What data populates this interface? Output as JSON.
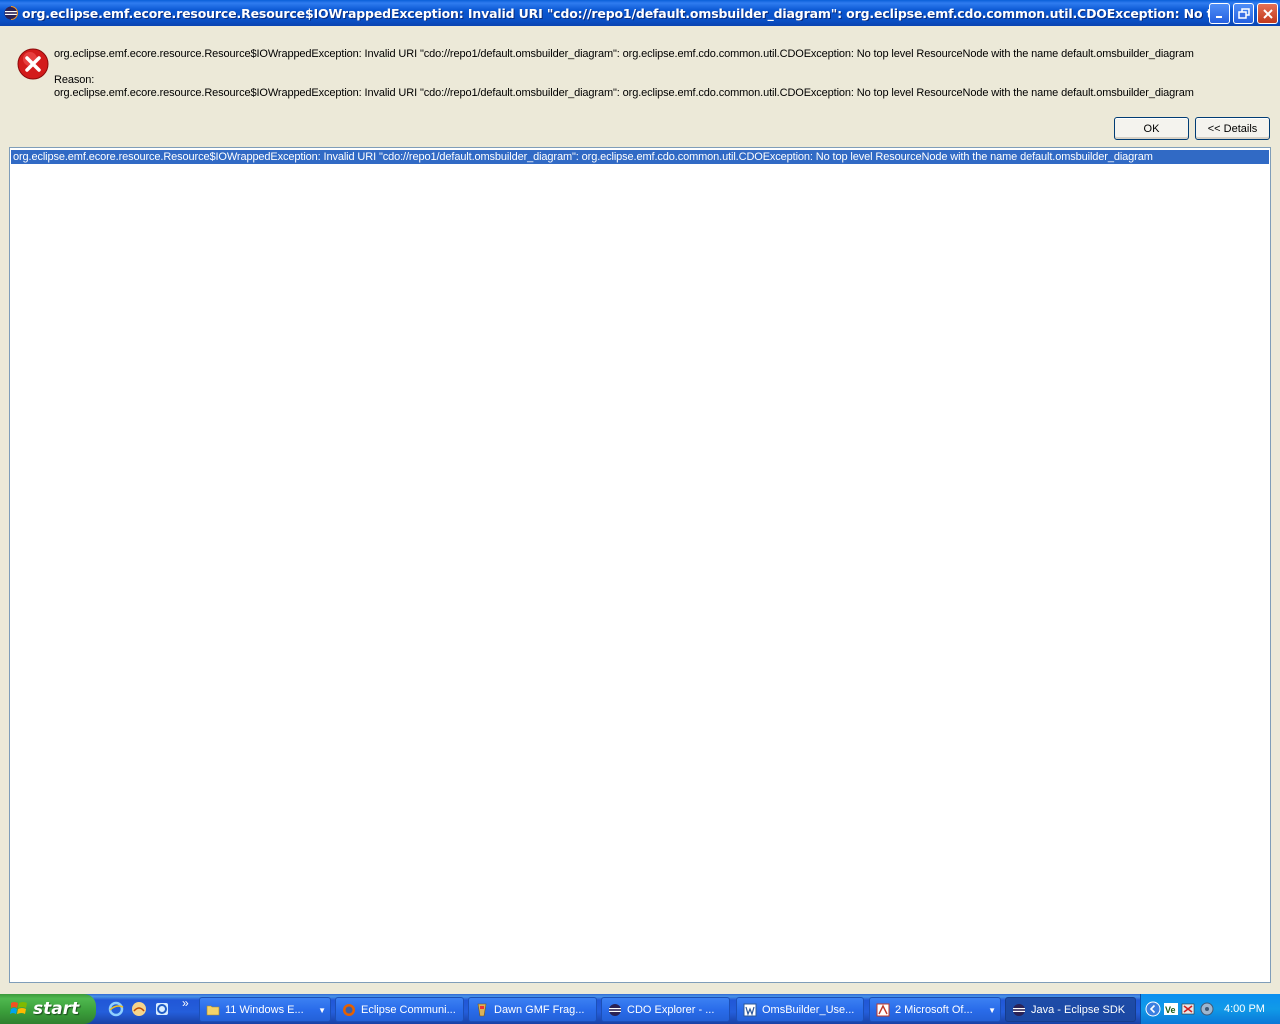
{
  "window": {
    "title": "org.eclipse.emf.ecore.resource.Resource$IOWrappedException: Invalid URI \"cdo://repo1/default.omsbuilder_diagram\": org.eclipse.emf.cdo.common.util.CDOException: No top level Resour..."
  },
  "dialog": {
    "message": "org.eclipse.emf.ecore.resource.Resource$IOWrappedException: Invalid URI \"cdo://repo1/default.omsbuilder_diagram\": org.eclipse.emf.cdo.common.util.CDOException: No top level ResourceNode with the name default.omsbuilder_diagram",
    "reason_label": "Reason:",
    "reason": "org.eclipse.emf.ecore.resource.Resource$IOWrappedException: Invalid URI \"cdo://repo1/default.omsbuilder_diagram\": org.eclipse.emf.cdo.common.util.CDOException: No top level ResourceNode with the name default.omsbuilder_diagram",
    "ok_label": "OK",
    "details_label": "<< Details",
    "details_rows": [
      "org.eclipse.emf.ecore.resource.Resource$IOWrappedException: Invalid URI \"cdo://repo1/default.omsbuilder_diagram\": org.eclipse.emf.cdo.common.util.CDOException: No top level ResourceNode with the name default.omsbuilder_diagram"
    ]
  },
  "taskbar": {
    "start_label": "start",
    "tasks": [
      {
        "label": "11 Windows E...",
        "icon": "folder-icon"
      },
      {
        "label": "Eclipse Communi...",
        "icon": "firefox-icon"
      },
      {
        "label": "Dawn GMF Frag...",
        "icon": "paint-icon"
      },
      {
        "label": "CDO Explorer - ...",
        "icon": "eclipse-icon"
      },
      {
        "label": "OmsBuilder_Use...",
        "icon": "word-icon"
      },
      {
        "label": "2 Microsoft Of...",
        "icon": "office-icon"
      },
      {
        "label": "Java - Eclipse SDK",
        "icon": "eclipse-icon"
      }
    ],
    "clock": "4:00 PM"
  },
  "colors": {
    "titlebar": "#0b58d3",
    "selection": "#316ac5",
    "dialog_bg": "#ece9d8",
    "taskbar": "#245edb",
    "start": "#3a9d3a"
  }
}
